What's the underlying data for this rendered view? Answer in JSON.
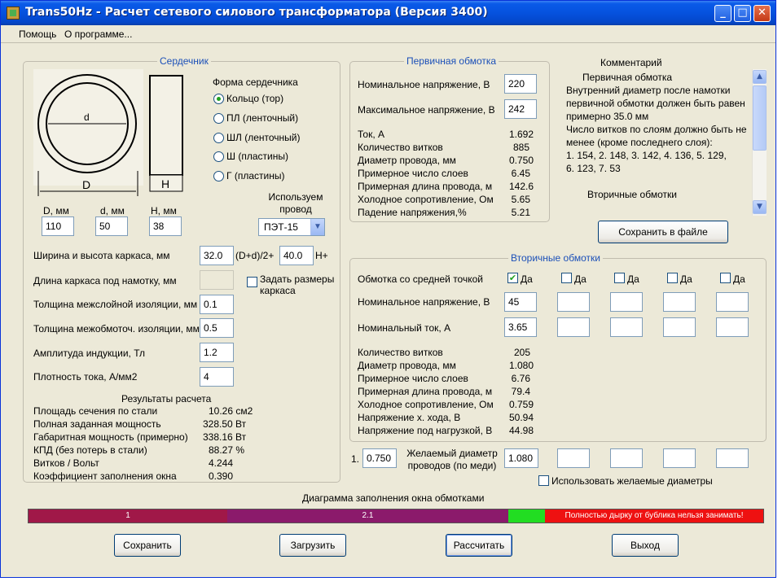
{
  "window": {
    "title": "Trans50Hz - Расчет сетевого силового трансформатора (Версия 3400)",
    "min_glyph": "_",
    "max_glyph": "□",
    "close_glyph": "✕"
  },
  "menu": [
    "Помощь",
    "О программе..."
  ],
  "core": {
    "legend": "Сердечник",
    "shape_label": "Форма сердечника",
    "shapes": [
      {
        "label": "Кольцо  (тор)",
        "selected": true
      },
      {
        "label": "ПЛ  (ленточный)",
        "selected": false
      },
      {
        "label": "ШЛ  (ленточный)",
        "selected": false
      },
      {
        "label": "Ш  (пластины)",
        "selected": false
      },
      {
        "label": "Г (пластины)",
        "selected": false
      }
    ],
    "diagram_labels": {
      "d": "d",
      "D": "D",
      "H": "H"
    },
    "dims": [
      {
        "label": "D, мм",
        "value": "110"
      },
      {
        "label": "d, мм",
        "value": "50"
      },
      {
        "label": "H, мм",
        "value": "38"
      }
    ],
    "wire_label": "Используем провод",
    "wire_value": "ПЭТ-15",
    "frame_label": "Ширина и высота каркаса, мм",
    "frame_w": "32.0",
    "frame_mid": "(D+d)/2+",
    "frame_h": "40.0",
    "frame_suffix": "H+",
    "frame_len_label": "Длина каркаса под намотку, мм",
    "frame_len_value": "",
    "set_frame_label": "Задать размеры каркаса",
    "params": [
      {
        "label": "Толщина межслойной изоляции, мм",
        "value": "0.1"
      },
      {
        "label": "Толщина межобмоточ. изоляции, мм",
        "value": "0.5"
      },
      {
        "label": "Амплитуда индукции, Тл",
        "value": "1.2"
      },
      {
        "label": "Плотность тока, А/мм2",
        "value": "4"
      }
    ],
    "results_title": "Результаты расчета",
    "results": [
      {
        "label": "Площадь сечения по стали",
        "value": "10.26 см2"
      },
      {
        "label": "Полная заданная мощность",
        "value": "328.50 Вт"
      },
      {
        "label": "Габаритная мощность (примерно)",
        "value": "338.16 Вт"
      },
      {
        "label": "КПД (без потерь в стали)",
        "value": "88.27 %"
      },
      {
        "label": "Витков / Вольт",
        "value": "4.244"
      },
      {
        "label": "Коэффициент заполнения окна",
        "value": "0.390"
      }
    ]
  },
  "primary": {
    "legend": "Первичная обмотка",
    "nominal_label": "Номинальное напряжение, В",
    "nominal_value": "220",
    "max_label": "Максимальное напряжение, В",
    "max_value": "242",
    "rows": [
      {
        "label": "Ток, А",
        "value": "1.692"
      },
      {
        "label": "Количество витков",
        "value": "885"
      },
      {
        "label": "Диаметр провода, мм",
        "value": "0.750"
      },
      {
        "label": "Примерное число слоев",
        "value": "6.45"
      },
      {
        "label": "Примерная длина провода, м",
        "value": "142.6"
      },
      {
        "label": "Холодное сопротивление, Ом",
        "value": "5.65"
      },
      {
        "label": "Падение напряжения,%",
        "value": "5.21"
      }
    ]
  },
  "comment": {
    "title": "Комментарий",
    "lines": [
      "Первичная обмотка",
      "Внутренний диаметр после намотки",
      "первичной обмотки должен быть равен",
      "примерно 35.0 мм",
      "Число витков по слоям должно быть не",
      "менее (кроме последнего слоя):",
      "1. 154,  2. 148,  3. 142,  4. 136,  5. 129,",
      "6. 123,  7. 53",
      "",
      "Вторичные обмотки"
    ],
    "save_button": "Сохранить в файле",
    "scroll_up": "▲",
    "scroll_down": "▼"
  },
  "secondary": {
    "legend": "Вторичные обмотки",
    "midpoint_label": "Обмотка со средней точкой",
    "check_label": "Да",
    "check_mark": "✔",
    "checks": [
      true,
      false,
      false,
      false,
      false
    ],
    "nominal_v_label": "Номинальное напряжение, В",
    "nominal_v_values": [
      "45",
      "",
      "",
      "",
      ""
    ],
    "nominal_i_label": "Номинальный ток, А",
    "nominal_i_values": [
      "3.65",
      "",
      "",
      "",
      ""
    ],
    "rows": [
      {
        "label": "Количество витков",
        "value": "205"
      },
      {
        "label": "Диаметр провода, мм",
        "value": "1.080"
      },
      {
        "label": "Примерное число слоев",
        "value": "6.76"
      },
      {
        "label": "Примерная длина провода, м",
        "value": "79.4"
      },
      {
        "label": "Холодное сопротивление, Ом",
        "value": "0.759"
      },
      {
        "label": "Напряжение х. хода, В",
        "value": "50.94"
      },
      {
        "label": "Напряжение под нагрузкой, В",
        "value": "44.98"
      }
    ],
    "desired_prefix": "1.",
    "desired_primary": "0.750",
    "desired_label": "Желаемый диаметр проводов  (по меди)",
    "desired_values": [
      "1.080",
      "",
      "",
      "",
      ""
    ],
    "use_desired_label": "Использовать желаемые диаметры"
  },
  "diagram": {
    "title": "Диаграмма заполнения окна обмотками",
    "segments": [
      {
        "label": "1",
        "fraction": 0.27,
        "color": "#a01848"
      },
      {
        "label": "2.1",
        "fraction": 0.382,
        "color": "#8b1a6b"
      },
      {
        "label": "",
        "fraction": 0.05,
        "color": "#22dd22"
      },
      {
        "label": "Полностью дырку от бублика нельзя занимать!",
        "fraction": 0.298,
        "color": "#ee1111"
      }
    ]
  },
  "buttons": {
    "save": "Сохранить",
    "load": "Загрузить",
    "calc": "Рассчитать",
    "exit": "Выход"
  }
}
